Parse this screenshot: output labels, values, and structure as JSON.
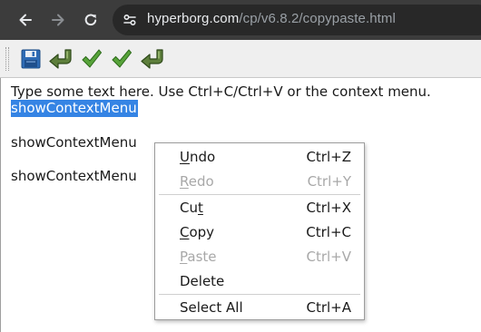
{
  "browser": {
    "url_host": "hyperborg.com",
    "url_path": "/cp/v6.8.2/copypaste.html",
    "icons": [
      "back-arrow-icon",
      "forward-arrow-icon",
      "reload-icon",
      "site-info-icon"
    ],
    "colors": {
      "chrome": "#3c3c3c",
      "omnibox": "#282828"
    }
  },
  "toolbar": {
    "icons": [
      "save-icon",
      "undo-arrow-icon",
      "check-icon",
      "check-icon",
      "redo-arrow-icon"
    ]
  },
  "editor": {
    "line1": "Type some text here. Use Ctrl+C/Ctrl+V or the context menu.",
    "line2": "showContextMenu",
    "line3": "showContextMenu",
    "line4": "showContextMenu",
    "selection_color": "#3584e4"
  },
  "context_menu": {
    "items": [
      {
        "pre": "",
        "mnemonic": "U",
        "post": "ndo",
        "shortcut": "Ctrl+Z",
        "enabled": true
      },
      {
        "pre": "",
        "mnemonic": "R",
        "post": "edo",
        "shortcut": "Ctrl+Y",
        "enabled": false
      },
      {
        "pre": "Cu",
        "mnemonic": "t",
        "post": "",
        "shortcut": "Ctrl+X",
        "enabled": true
      },
      {
        "pre": "",
        "mnemonic": "C",
        "post": "opy",
        "shortcut": "Ctrl+C",
        "enabled": true
      },
      {
        "pre": "",
        "mnemonic": "P",
        "post": "aste",
        "shortcut": "Ctrl+V",
        "enabled": false
      },
      {
        "pre": "Delete",
        "mnemonic": "",
        "post": "",
        "shortcut": "",
        "enabled": true
      },
      {
        "pre": "Select All",
        "mnemonic": "",
        "post": "",
        "shortcut": "Ctrl+A",
        "enabled": true
      }
    ]
  }
}
